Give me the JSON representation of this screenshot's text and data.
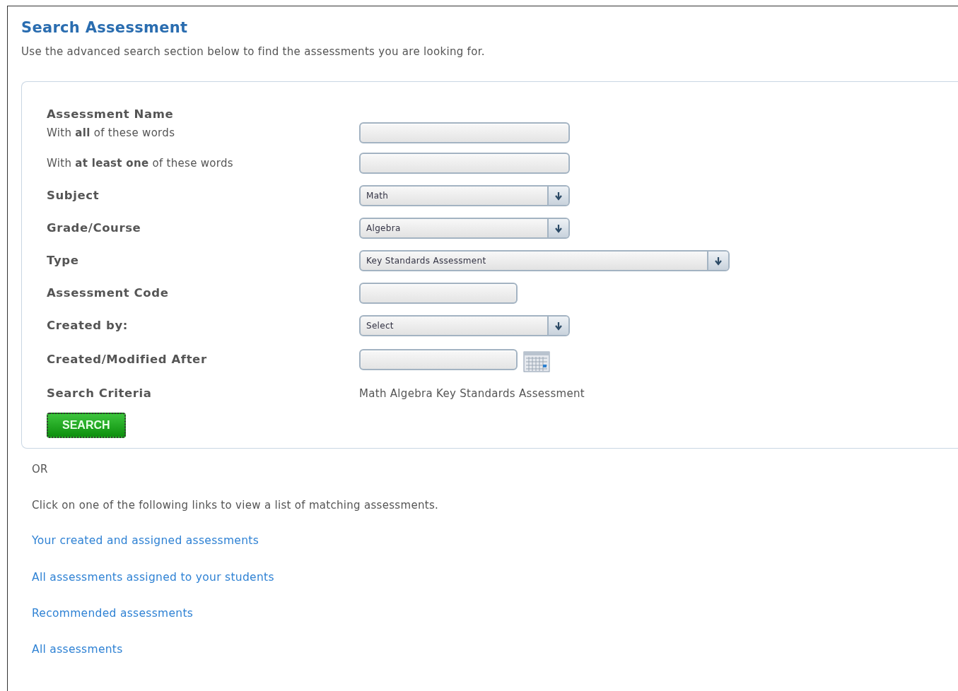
{
  "title": "Search Assessment",
  "intro": "Use the advanced search section below to find the assessments you are looking for.",
  "form": {
    "groups": [
      {
        "label": "Assessment Name",
        "fields": [
          {
            "kind": "text",
            "label": "With **all** of these words"
          },
          {
            "kind": "text",
            "label": "With **at least one** of these words"
          }
        ]
      },
      {
        "label": "Subject",
        "fields": [
          {
            "kind": "select",
            "value": "Math"
          }
        ]
      },
      {
        "label": "Grade/Course",
        "fields": [
          {
            "kind": "select",
            "value": "Algebra"
          }
        ]
      },
      {
        "label": "Type",
        "fields": [
          {
            "kind": "select",
            "value": "Key Standards Assessment"
          }
        ]
      },
      {
        "label": "Assessment Code",
        "fields": [
          {
            "kind": "text"
          }
        ]
      },
      {
        "label": "Created by:",
        "fields": [
          {
            "kind": "select",
            "value": "Select"
          }
        ]
      },
      {
        "label": "Created/Modified After",
        "fields": [
          {
            "kind": "date"
          }
        ]
      },
      {
        "label": "Search Criteria",
        "fields": [
          {
            "kind": "readonly",
            "value": "Math Algebra Key Standards Assessment"
          }
        ]
      }
    ],
    "button": "SEARCH"
  },
  "or_text": "OR",
  "links_intro": "Click on one of the following links to view a list of matching assessments.",
  "links": [
    "Your created and assigned assessments",
    "All assessments assigned to your students",
    "Recommended assessments",
    "All assessments"
  ]
}
